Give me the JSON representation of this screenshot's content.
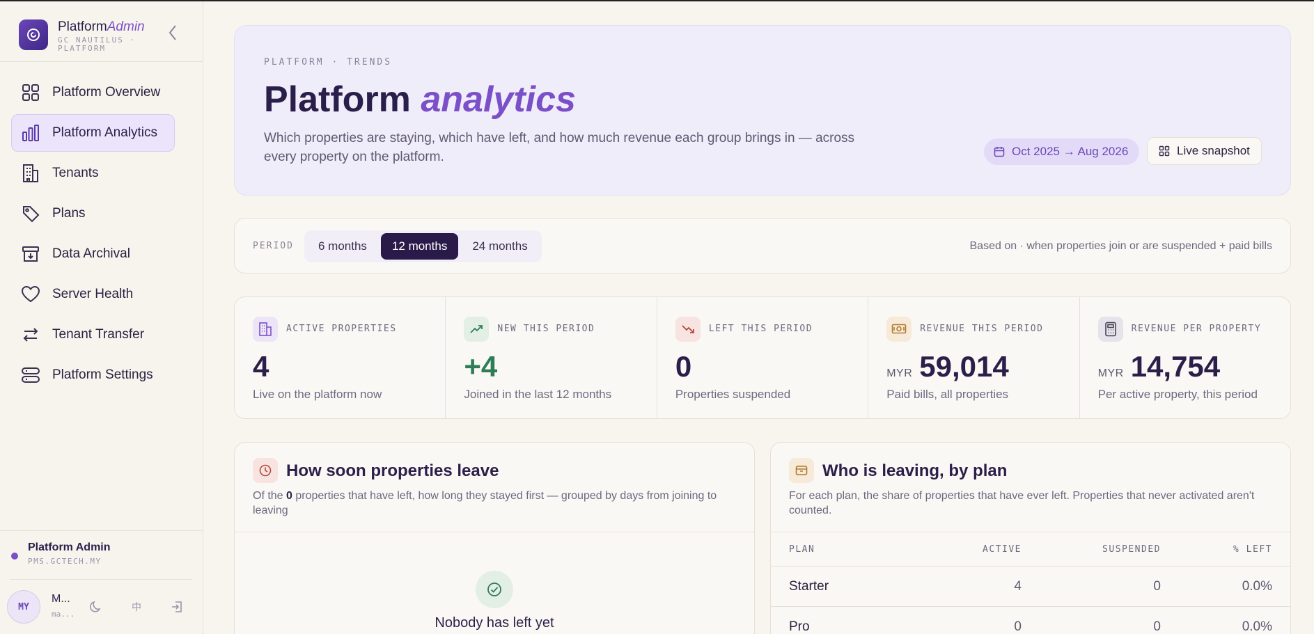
{
  "brand": {
    "title_a": "Platform",
    "title_b": "Admin",
    "subtitle": "GC NAUTILUS · PLATFORM"
  },
  "nav": [
    {
      "label": "Platform Overview",
      "icon": "grid-icon"
    },
    {
      "label": "Platform Analytics",
      "icon": "bar-chart-icon",
      "active": true
    },
    {
      "label": "Tenants",
      "icon": "building-icon"
    },
    {
      "label": "Plans",
      "icon": "tag-icon"
    },
    {
      "label": "Data Archival",
      "icon": "archive-icon"
    },
    {
      "label": "Server Health",
      "icon": "heart-icon"
    },
    {
      "label": "Tenant Transfer",
      "icon": "transfer-arrows-icon"
    },
    {
      "label": "Platform Settings",
      "icon": "server-stack-icon"
    }
  ],
  "admin": {
    "name": "Platform Admin",
    "host": "PMS.GCTECH.MY"
  },
  "user": {
    "initials": "MY",
    "name": "M...",
    "email": "ma...",
    "lang": "中"
  },
  "hero": {
    "eyebrow": "PLATFORM · TRENDS",
    "title_a": "Platform",
    "title_b": "analytics",
    "description": "Which properties are staying, which have left, and how much revenue each group brings in — across every property on the platform.",
    "date_range": "Oct 2025 → Aug 2026",
    "snapshot_label": "Live snapshot"
  },
  "period": {
    "label": "PERIOD",
    "options": [
      "6 months",
      "12 months",
      "24 months"
    ],
    "selected": "12 months",
    "note": "Based on · when properties join or are suspended + paid bills"
  },
  "kpis": [
    {
      "label": "ACTIVE PROPERTIES",
      "currency": "",
      "value": "4",
      "sub": "Live on the platform now",
      "icon": "building-icon",
      "icon_bg": "#ebe5f7",
      "icon_color": "#7b4fc8"
    },
    {
      "label": "NEW THIS PERIOD",
      "currency": "",
      "value": "+4",
      "sub": "Joined in the last 12 months",
      "icon": "trend-up-icon",
      "icon_bg": "#e3efe5",
      "icon_color": "#2f7d56"
    },
    {
      "label": "LEFT THIS PERIOD",
      "currency": "",
      "value": "0",
      "sub": "Properties suspended",
      "icon": "trend-down-icon",
      "icon_bg": "#f7e3e0",
      "icon_color": "#b8483c"
    },
    {
      "label": "REVENUE THIS PERIOD",
      "currency": "MYR",
      "value": "59,014",
      "sub": "Paid bills, all properties",
      "icon": "banknote-icon",
      "icon_bg": "#f7ead8",
      "icon_color": "#b07a2e"
    },
    {
      "label": "REVENUE PER PROPERTY",
      "currency": "MYR",
      "value": "14,754",
      "sub": "Per active property, this period",
      "icon": "calculator-icon",
      "icon_bg": "#e6e3ea",
      "icon_color": "#4a4458"
    }
  ],
  "leave_panel": {
    "title": "How soon properties leave",
    "desc_prefix": "Of the ",
    "desc_count": "0",
    "desc_suffix": " properties that have left, how long they stayed first — grouped by days from joining to leaving",
    "empty_title": "Nobody has left yet"
  },
  "plan_panel": {
    "title": "Who is leaving, by plan",
    "desc": "For each plan, the share of properties that have ever left. Properties that never activated aren't counted.",
    "columns": [
      "PLAN",
      "ACTIVE",
      "SUSPENDED",
      "% LEFT"
    ],
    "rows": [
      {
        "plan": "Starter",
        "active": "4",
        "suspended": "0",
        "left": "0.0%"
      },
      {
        "plan": "Pro",
        "active": "0",
        "suspended": "0",
        "left": "0.0%"
      }
    ]
  },
  "colors": {
    "accent": "#7b4fc8",
    "dark": "#2a1a4a",
    "green": "#2f7d56",
    "red": "#b8483c"
  }
}
